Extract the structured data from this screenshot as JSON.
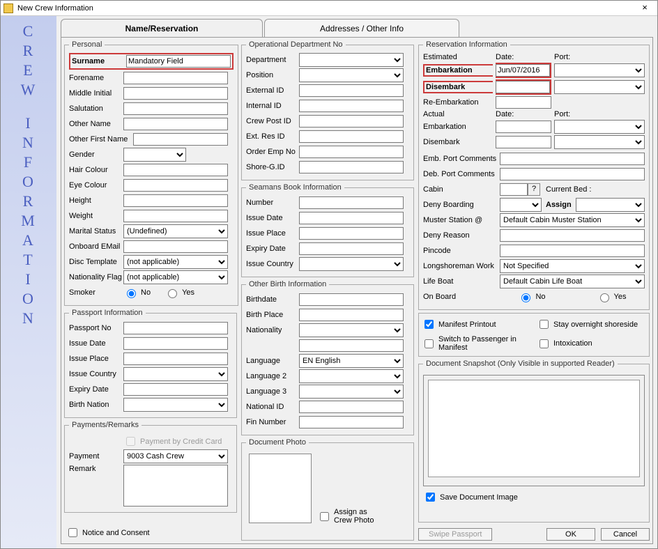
{
  "window": {
    "title": "New Crew Information",
    "close": "×"
  },
  "sidebar": [
    "C",
    "R",
    "E",
    "W",
    "",
    "I",
    "N",
    "F",
    "O",
    "R",
    "M",
    "A",
    "T",
    "I",
    "O",
    "N"
  ],
  "tabs": {
    "t1": "Name/Reservation",
    "t2": "Addresses / Other Info"
  },
  "personal": {
    "legend": "Personal",
    "surname_lbl": "Surname",
    "surname_val": "Mandatory Field",
    "forename_lbl": "Forename",
    "forename_val": "",
    "middle_lbl": "Middle Initial",
    "middle_val": "",
    "salut_lbl": "Salutation",
    "salut_val": "",
    "othername_lbl": "Other Name",
    "othername_val": "",
    "otherfirst_lbl": "Other First Name",
    "otherfirst_val": "",
    "gender_lbl": "Gender",
    "gender_val": "",
    "hair_lbl": "Hair Colour",
    "hair_val": "",
    "eye_lbl": "Eye Colour",
    "eye_val": "",
    "height_lbl": "Height",
    "height_val": "",
    "weight_lbl": "Weight",
    "weight_val": "",
    "marital_lbl": "Marital Status",
    "marital_val": "(Undefined)",
    "email_lbl": "Onboard EMail",
    "email_val": "",
    "disc_lbl": "Disc Template",
    "disc_val": "(not applicable)",
    "natflag_lbl": "Nationality Flag",
    "natflag_val": "(not applicable)",
    "smoker_lbl": "Smoker",
    "smoker_no": "No",
    "smoker_yes": "Yes"
  },
  "passport": {
    "legend": "Passport Information",
    "no_lbl": "Passport No",
    "no_val": "",
    "issdate_lbl": "Issue Date",
    "issdate_val": "",
    "issplace_lbl": "Issue Place",
    "issplace_val": "",
    "isscountry_lbl": "Issue Country",
    "isscountry_val": "",
    "exp_lbl": "Expiry Date",
    "exp_val": "",
    "birth_lbl": "Birth Nation",
    "birth_val": ""
  },
  "payments": {
    "legend": "Payments/Remarks",
    "bycard_lbl": "Payment by Credit Card",
    "payment_lbl": "Payment",
    "payment_val": "9003  Cash Crew",
    "remark_lbl": "Remark",
    "remark_val": ""
  },
  "opdept": {
    "legend": "Operational Department No",
    "dept_lbl": "Department",
    "dept_val": "",
    "pos_lbl": "Position",
    "pos_val": "",
    "extid_lbl": "External ID",
    "extid_val": "",
    "intid_lbl": "Internal ID",
    "intid_val": "",
    "crewpost_lbl": "Crew Post ID",
    "crewpost_val": "",
    "extres_lbl": "Ext. Res ID",
    "extres_val": "",
    "orderemp_lbl": "Order Emp No",
    "orderemp_val": "",
    "shoreg_lbl": "Shore-G.ID",
    "shoreg_val": ""
  },
  "seamans": {
    "legend": "Seamans Book Information",
    "num_lbl": "Number",
    "num_val": "",
    "issdate_lbl": "Issue Date",
    "issdate_val": "",
    "issplace_lbl": "Issue Place",
    "issplace_val": "",
    "exp_lbl": "Expiry Date",
    "exp_val": "",
    "isscountry_lbl": "Issue Country",
    "isscountry_val": ""
  },
  "birth": {
    "legend": "Other Birth Information",
    "bdate_lbl": "Birthdate",
    "bdate_val": "",
    "bplace_lbl": "Birth Place",
    "bplace_val": "",
    "nat_lbl": "Nationality",
    "nat_val": "",
    "lang_lbl": "Language",
    "lang_val": "EN English",
    "lang2_lbl": "Language 2",
    "lang2_val": "",
    "lang3_lbl": "Language 3",
    "lang3_val": "",
    "natid_lbl": "National ID",
    "natid_val": "",
    "fin_lbl": "Fin Number",
    "fin_val": ""
  },
  "docphoto": {
    "legend": "Document Photo",
    "assign_lbl": "Assign as Crew Photo"
  },
  "reservation": {
    "legend": "Reservation Information",
    "estimated": "Estimated",
    "date_h": "Date:",
    "port_h": "Port:",
    "emb_lbl": "Embarkation",
    "emb_date": "Jun/07/2016",
    "emb_port": "",
    "dis_lbl": "Disembark",
    "dis_date": "",
    "dis_port": "",
    "reemb_lbl": "Re-Embarkation",
    "reemb_val": "",
    "actual": "Actual",
    "date_h2": "Date:",
    "port_h2": "Port:",
    "aemb_lbl": "Embarkation",
    "aemb_date": "",
    "aemb_port": "",
    "adis_lbl": "Disembark",
    "adis_date": "",
    "adis_port": "",
    "embcom_lbl": "Emb. Port Comments",
    "embcom_val": "",
    "debcom_lbl": "Deb. Port Comments",
    "debcom_val": "",
    "cabin_lbl": "Cabin",
    "cabin_val": "",
    "q": "?",
    "curbed_lbl": "Current Bed :",
    "deny_lbl": "Deny Boarding",
    "deny_val": "",
    "assign_lbl": "Assign",
    "assign_val": "",
    "muster_lbl": "Muster Station @",
    "muster_val": "Default Cabin Muster Station",
    "denyreason_lbl": "Deny Reason",
    "denyreason_val": "",
    "pin_lbl": "Pincode",
    "pin_val": "",
    "longshore_lbl": "Longshoreman Work",
    "longshore_val": "Not Specified",
    "lifeboat_lbl": "Life Boat",
    "lifeboat_val": "Default Cabin Life Boat",
    "onboard_lbl": "On Board",
    "onboard_no": "No",
    "onboard_yes": "Yes",
    "manifest_lbl": "Manifest Printout",
    "stayov_lbl": "Stay overnight shoreside",
    "switch_lbl": "Switch to Passenger in Manifest",
    "intox_lbl": "Intoxication"
  },
  "snapshot": {
    "legend": "Document Snapshot (Only Visible in supported Reader)",
    "save_lbl": "Save Document Image"
  },
  "buttons": {
    "swipe": "Swipe Passport",
    "ok": "OK",
    "cancel": "Cancel"
  },
  "notice_lbl": "Notice and Consent"
}
